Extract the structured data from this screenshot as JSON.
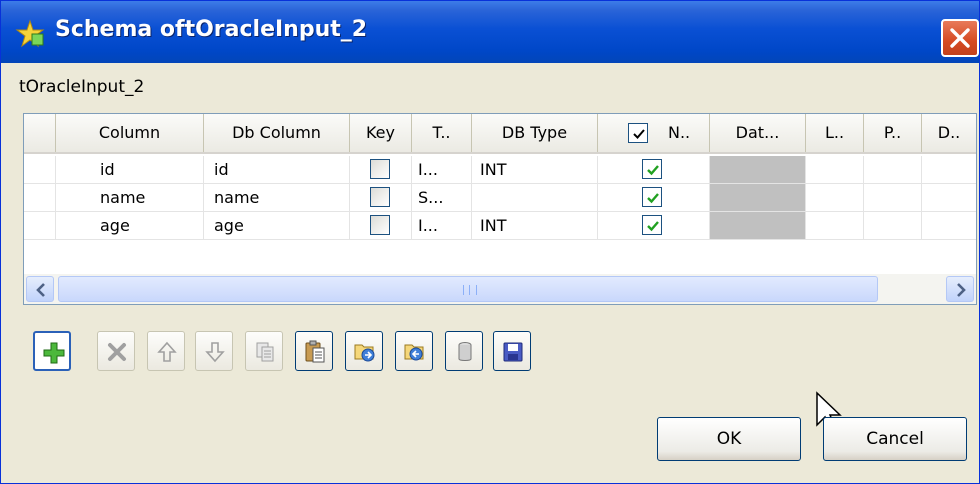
{
  "window": {
    "title": "Schema oftOracleInput_2"
  },
  "component_name": "tOracleInput_2",
  "table": {
    "columns": [
      "Column",
      "Db Column",
      "Key",
      "T..",
      "DB Type",
      "N..",
      "Dat...",
      "L..",
      "P..",
      "D.."
    ],
    "rows": [
      {
        "column": "id",
        "db_column": "id",
        "key": false,
        "type": "I...",
        "db_type": "INT",
        "nullable": true
      },
      {
        "column": "name",
        "db_column": "name",
        "key": false,
        "type": "S...",
        "db_type": "",
        "nullable": true
      },
      {
        "column": "age",
        "db_column": "age",
        "key": false,
        "type": "I...",
        "db_type": "INT",
        "nullable": true
      }
    ],
    "nullable_header_checked": true
  },
  "toolbar": {
    "icons": [
      "add-icon",
      "remove-icon",
      "move-up-icon",
      "move-down-icon",
      "copy-icon",
      "paste-icon",
      "import-icon",
      "export-icon",
      "database-icon",
      "save-icon"
    ]
  },
  "buttons": {
    "ok": "OK",
    "cancel": "Cancel"
  },
  "colors": {
    "titlebar": "#0a50d4",
    "accent": "#316ac5",
    "check": "#21a121"
  }
}
